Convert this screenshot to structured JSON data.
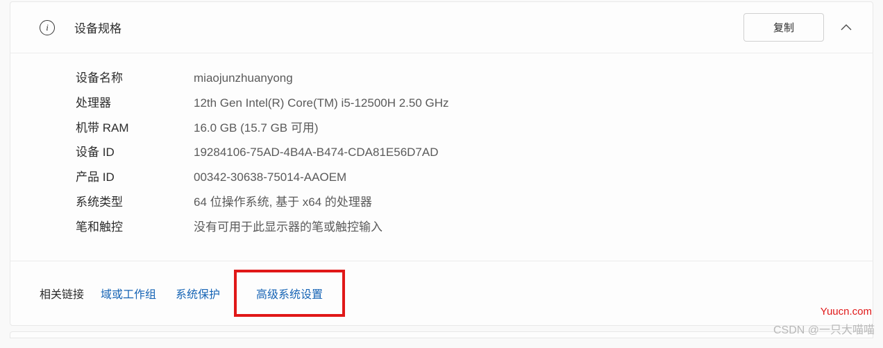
{
  "header": {
    "title": "设备规格",
    "copy_label": "复制"
  },
  "specs": [
    {
      "label": "设备名称",
      "value": "miaojunzhuanyong"
    },
    {
      "label": "处理器",
      "value": "12th Gen Intel(R) Core(TM) i5-12500H   2.50 GHz"
    },
    {
      "label": "机带 RAM",
      "value": "16.0 GB (15.7 GB 可用)"
    },
    {
      "label": "设备 ID",
      "value": "19284106-75AD-4B4A-B474-CDA81E56D7AD"
    },
    {
      "label": "产品 ID",
      "value": "00342-30638-75014-AAOEM"
    },
    {
      "label": "系统类型",
      "value": "64 位操作系统, 基于 x64 的处理器"
    },
    {
      "label": "笔和触控",
      "value": "没有可用于此显示器的笔或触控输入"
    }
  ],
  "footer": {
    "related_label": "相关链接",
    "links": {
      "domain": "域或工作组",
      "protection": "系统保护",
      "advanced": "高级系统设置"
    }
  },
  "watermark": {
    "red": "Yuucn.com",
    "gray": "CSDN @一只大喵喵"
  }
}
